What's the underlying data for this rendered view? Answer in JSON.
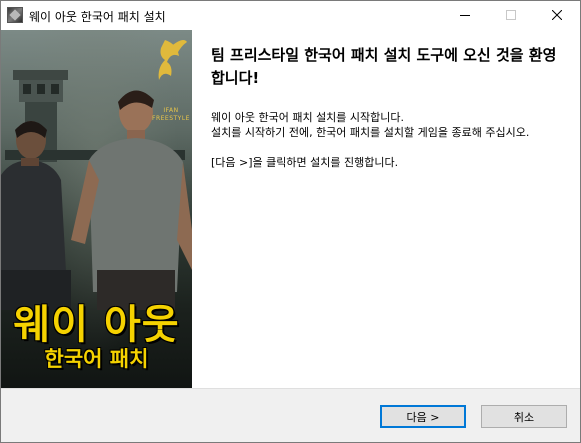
{
  "window": {
    "title": "웨이 아웃 한국어 패치 설치"
  },
  "banner": {
    "title": "웨이 아웃",
    "subtitle": "한국어 패치",
    "logo_line1": "IFAN",
    "logo_line2": "FREESTYLE"
  },
  "content": {
    "heading": "팀 프리스타일 한국어 패치 설치 도구에 오신 것을 환영합니다!",
    "paragraph1": "웨이 아웃 한국어 패치 설치를 시작합니다.\n설치를 시작하기 전에, 한국어 패치를 설치할 게임을 종료해 주십시오.",
    "paragraph2": "[다음 >]을 클릭하면 설치를 진행합니다."
  },
  "buttons": {
    "next": "다음 >",
    "cancel": "취소"
  },
  "colors": {
    "banner_text": "#f5d200",
    "focus_border": "#0078d7",
    "footer_bg": "#f0f0f0"
  }
}
